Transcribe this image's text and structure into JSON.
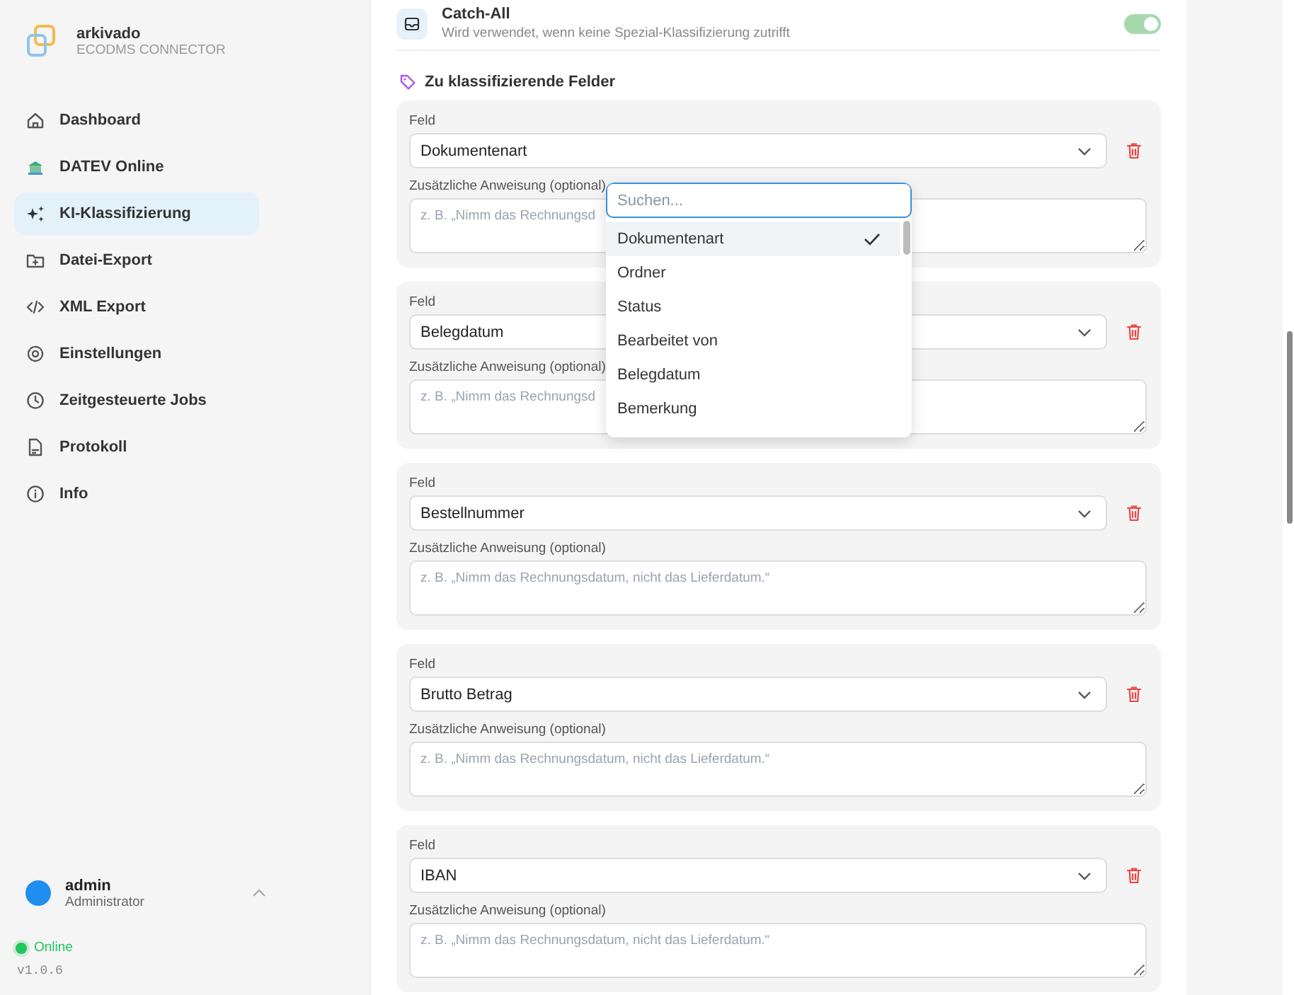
{
  "app": {
    "name": "arkivado",
    "subtitle": "ECODMS CONNECTOR"
  },
  "nav": [
    {
      "label": "Dashboard",
      "selected": false
    },
    {
      "label": "DATEV Online",
      "selected": false
    },
    {
      "label": "KI-Klassifizierung",
      "selected": true
    },
    {
      "label": "Datei-Export",
      "selected": false
    },
    {
      "label": "XML Export",
      "selected": false
    },
    {
      "label": "Einstellungen",
      "selected": false
    },
    {
      "label": "Zeitgesteuerte Jobs",
      "selected": false
    },
    {
      "label": "Protokoll",
      "selected": false
    },
    {
      "label": "Info",
      "selected": false
    }
  ],
  "user": {
    "name": "admin",
    "role": "Administrator"
  },
  "connection": {
    "label": "Online",
    "color": "#22c55e"
  },
  "version": "v1.0.6",
  "catch_all": {
    "title": "Catch-All",
    "description": "Wird verwendet, wenn keine Spezial-Klassifizierung zutrifft",
    "on": true
  },
  "fields_heading": "Zu klassifizierende Felder",
  "field_cards": [
    {
      "field_label": "Feld",
      "value": "Dokumentenart",
      "instruction_label": "Zusätzliche Anweisung (optional)",
      "placeholder": "z. B. „Nimm das Rechnungsd"
    },
    {
      "field_label": "Feld",
      "value": "Belegdatum",
      "instruction_label": "Zusätzliche Anweisung (optional)",
      "placeholder": "z. B. „Nimm das Rechnungsd"
    },
    {
      "field_label": "Feld",
      "value": "Bestellnummer",
      "instruction_label": "Zusätzliche Anweisung (optional)",
      "placeholder": "z. B. „Nimm das Rechnungsdatum, nicht das Lieferdatum.“"
    },
    {
      "field_label": "Feld",
      "value": "Brutto Betrag",
      "instruction_label": "Zusätzliche Anweisung (optional)",
      "placeholder": "z. B. „Nimm das Rechnungsdatum, nicht das Lieferdatum.“"
    },
    {
      "field_label": "Feld",
      "value": "IBAN",
      "instruction_label": "Zusätzliche Anweisung (optional)",
      "placeholder": "z. B. „Nimm das Rechnungsdatum, nicht das Lieferdatum.“"
    }
  ],
  "dropdown": {
    "placeholder": "Suchen...",
    "options": [
      {
        "label": "Dokumentenart",
        "selected": true
      },
      {
        "label": "Ordner",
        "selected": false
      },
      {
        "label": "Status",
        "selected": false
      },
      {
        "label": "Bearbeitet von",
        "selected": false
      },
      {
        "label": "Belegdatum",
        "selected": false
      },
      {
        "label": "Bemerkung",
        "selected": false
      }
    ]
  }
}
